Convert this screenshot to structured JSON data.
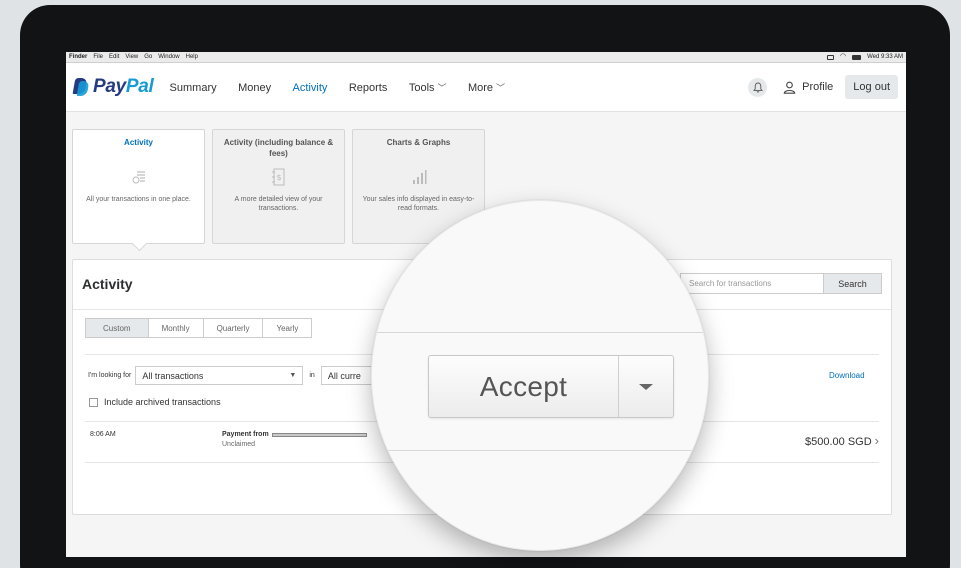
{
  "menubar": {
    "items": [
      "Finder",
      "File",
      "Edit",
      "View",
      "Go",
      "Window",
      "Help"
    ],
    "clock": "Wed 9:33 AM"
  },
  "header": {
    "logo_a": "Pay",
    "logo_b": "Pal",
    "nav": [
      "Summary",
      "Money",
      "Activity",
      "Reports",
      "Tools",
      "More"
    ],
    "active_nav": "Activity",
    "profile_label": "Profile",
    "logout_label": "Log out"
  },
  "cards": [
    {
      "title": "Activity",
      "desc": "All your transactions in one place.",
      "icon": "receipt-icon"
    },
    {
      "title": "Activity (including balance & fees)",
      "desc": "A more detailed view of your transactions.",
      "icon": "ledger-icon"
    },
    {
      "title": "Charts & Graphs",
      "desc": "Your sales info displayed in easy-to-read formats.",
      "icon": "bar-chart-icon"
    }
  ],
  "panel": {
    "title": "Activity",
    "search_placeholder": "Search for transactions",
    "search_button": "Search",
    "periods": [
      "Custom",
      "Monthly",
      "Quarterly",
      "Yearly"
    ],
    "filter_label": "I'm looking for",
    "filter_value": "All transactions",
    "in_label": "in",
    "currency_value": "All curre",
    "download": "Download",
    "archived_label": "Include archived transactions"
  },
  "transaction": {
    "time": "8:06 AM",
    "label": "Payment from",
    "status": "Unclaimed",
    "amount": "$500.00 SGD"
  },
  "magnifier": {
    "button_label": "Accept"
  },
  "colors": {
    "brand_dark": "#253b80",
    "brand_light": "#179bd7",
    "link": "#0070ba"
  }
}
